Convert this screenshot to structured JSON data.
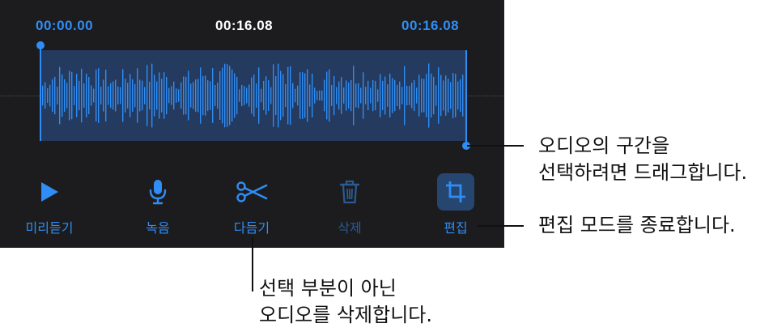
{
  "times": {
    "start": "00:00.00",
    "current": "00:16.08",
    "end": "00:16.08"
  },
  "waveform": {
    "accent": "#2f8df5",
    "selection_fill": "#243a5e"
  },
  "toolbar": {
    "preview": {
      "label": "미리듣기",
      "icon": "play-icon"
    },
    "record": {
      "label": "녹음",
      "icon": "microphone-icon"
    },
    "trim": {
      "label": "다듬기",
      "icon": "scissors-icon"
    },
    "delete": {
      "label": "삭제",
      "icon": "trash-icon"
    },
    "edit": {
      "label": "편집",
      "icon": "crop-icon"
    }
  },
  "callouts": {
    "drag_line1": "오디오의 구간을",
    "drag_line2": "선택하려면 드래그합니다.",
    "exit_edit": "편집 모드를 종료합니다.",
    "delete_line1": "선택 부분이 아닌",
    "delete_line2": "오디오를 삭제합니다."
  },
  "colors": {
    "panel_bg": "#1c1c1e",
    "accent": "#2f8df5",
    "disabled": "#2a5a93"
  }
}
